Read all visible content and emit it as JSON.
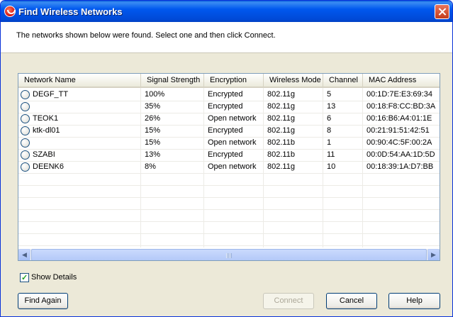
{
  "window": {
    "title": "Find Wireless Networks"
  },
  "instruction": "The networks shown below were found. Select one and then click Connect.",
  "columns": [
    "Network Name",
    "Signal Strength",
    "Encryption",
    "Wireless Mode",
    "Channel",
    "MAC Address"
  ],
  "networks": [
    {
      "name": "DEGF_TT",
      "signal": "100%",
      "encryption": "Encrypted",
      "mode": "802.11g",
      "channel": "5",
      "mac": "00:1D:7E:E3:69:34"
    },
    {
      "name": "",
      "signal": "35%",
      "encryption": "Encrypted",
      "mode": "802.11g",
      "channel": "13",
      "mac": "00:18:F8:CC:BD:3A"
    },
    {
      "name": "TEOK1",
      "signal": "26%",
      "encryption": "Open network",
      "mode": "802.11g",
      "channel": "6",
      "mac": "00:16:B6:A4:01:1E"
    },
    {
      "name": "ktk-dl01",
      "signal": "15%",
      "encryption": "Encrypted",
      "mode": "802.11g",
      "channel": "8",
      "mac": "00:21:91:51:42:51"
    },
    {
      "name": "",
      "signal": "15%",
      "encryption": "Open network",
      "mode": "802.11b",
      "channel": "1",
      "mac": "00:90:4C:5F:00:2A"
    },
    {
      "name": "SZABI",
      "signal": "13%",
      "encryption": "Encrypted",
      "mode": "802.11b",
      "channel": "11",
      "mac": "00:0D:54:AA:1D:5D"
    },
    {
      "name": "DEENK6",
      "signal": "8%",
      "encryption": "Open network",
      "mode": "802.11g",
      "channel": "10",
      "mac": "00:18:39:1A:D7:BB"
    }
  ],
  "show_details": {
    "label": "Show Details",
    "checked": true
  },
  "buttons": {
    "find_again": "Find Again",
    "connect": "Connect",
    "cancel": "Cancel",
    "help": "Help"
  },
  "icons": {
    "app": "wireless-app-icon",
    "close": "close-icon",
    "scroll_left": "arrow-left-icon",
    "scroll_right": "arrow-right-icon",
    "check": "checkmark-icon"
  },
  "colors": {
    "titlebar": "#0058ee",
    "dialog": "#ece9d8",
    "check": "#21a121"
  }
}
